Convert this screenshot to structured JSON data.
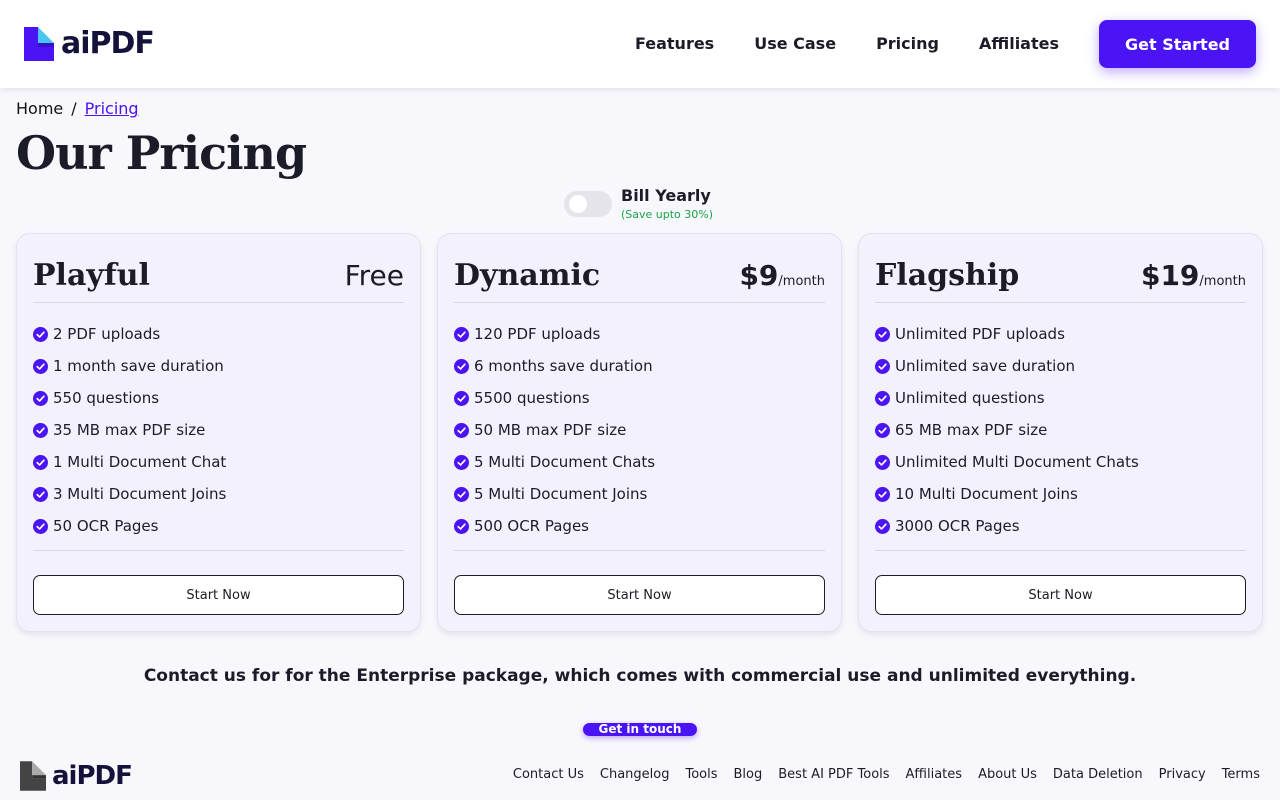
{
  "header": {
    "logo_text": "aiPDF",
    "nav": [
      "Features",
      "Use Case",
      "Pricing",
      "Affiliates"
    ],
    "cta_label": "Get Started"
  },
  "breadcrumb": {
    "home": "Home",
    "separator": "/",
    "current": "Pricing"
  },
  "page_title": "Our Pricing",
  "billing": {
    "label": "Bill Yearly",
    "save_note": "(Save upto 30%)",
    "toggle_on": false
  },
  "plans": [
    {
      "name": "Playful",
      "price": "Free",
      "period": "",
      "features": [
        "2 PDF uploads",
        "1 month save duration",
        "550 questions",
        "35 MB max PDF size",
        "1 Multi Document Chat",
        "3 Multi Document Joins",
        "50 OCR Pages"
      ],
      "button": "Start Now"
    },
    {
      "name": "Dynamic",
      "price": "$9",
      "period": "/month",
      "features": [
        "120 PDF uploads",
        "6 months save duration",
        "5500 questions",
        "50 MB max PDF size",
        "5 Multi Document Chats",
        "5 Multi Document Joins",
        "500 OCR Pages"
      ],
      "button": "Start Now"
    },
    {
      "name": "Flagship",
      "price": "$19",
      "period": "/month",
      "features": [
        "Unlimited PDF uploads",
        "Unlimited save duration",
        "Unlimited questions",
        "65 MB max PDF size",
        "Unlimited Multi Document Chats",
        "10 Multi Document Joins",
        "3000 OCR Pages"
      ],
      "button": "Start Now"
    }
  ],
  "enterprise": {
    "text": "Contact us for for the Enterprise package, which comes with commercial use and unlimited everything.",
    "button": "Get in touch"
  },
  "footer": {
    "logo_text": "aiPDF",
    "links": [
      "Contact Us",
      "Changelog",
      "Tools",
      "Blog",
      "Best AI PDF Tools",
      "Affiliates",
      "About Us",
      "Data Deletion",
      "Privacy",
      "Terms"
    ]
  },
  "colors": {
    "accent": "#4a14f5",
    "save_green": "#1aa34a",
    "logo_cyan": "#49c6f0"
  },
  "icons": {
    "feature": "check-circle-icon",
    "logo": "document-icon"
  }
}
